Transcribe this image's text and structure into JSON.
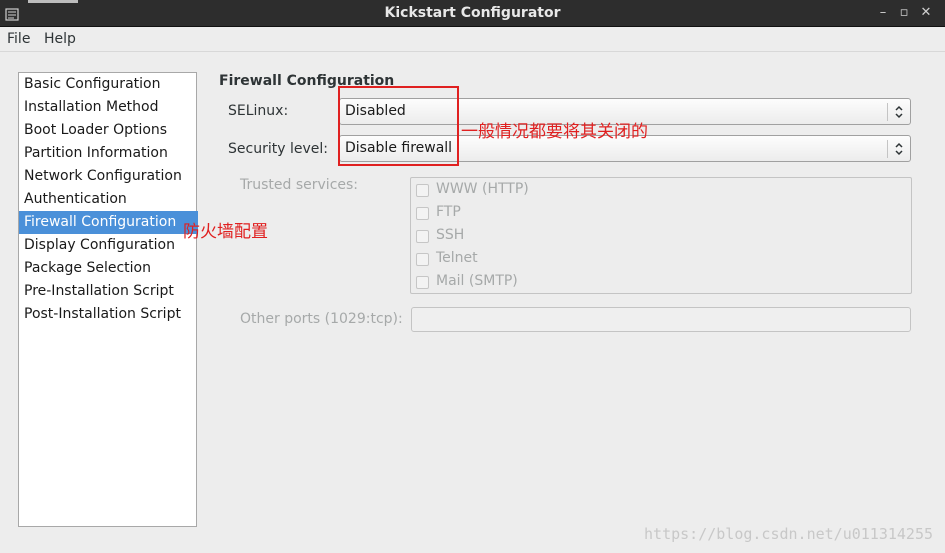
{
  "window": {
    "title": "Kickstart Configurator",
    "controls": {
      "minimize": "–",
      "maximize": "▫",
      "close": "✕"
    }
  },
  "menu": {
    "items": [
      "File",
      "Help"
    ]
  },
  "sidebar": {
    "selected": "Firewall Configuration",
    "items": [
      "Basic Configuration",
      "Installation Method",
      "Boot Loader Options",
      "Partition Information",
      "Network Configuration",
      "Authentication",
      "Firewall Configuration",
      "Display Configuration",
      "Package Selection",
      "Pre-Installation Script",
      "Post-Installation Script"
    ]
  },
  "firewall": {
    "section_title": "Firewall Configuration",
    "selinux_label": "SELinux:",
    "selinux_value": "Disabled",
    "security_label": "Security level:",
    "security_value": "Disable firewall",
    "trusted_label": "Trusted services:",
    "services": [
      "WWW (HTTP)",
      "FTP",
      "SSH",
      "Telnet",
      "Mail (SMTP)"
    ],
    "ports_label": "Other ports (1029:tcp):",
    "ports_value": ""
  },
  "annotations": {
    "selinux_note": "一般情况都要将其关闭的",
    "sidebar_note": "防火墙配置",
    "highlight_color": "#e02020"
  },
  "watermark": "https://blog.csdn.net/u011314255"
}
